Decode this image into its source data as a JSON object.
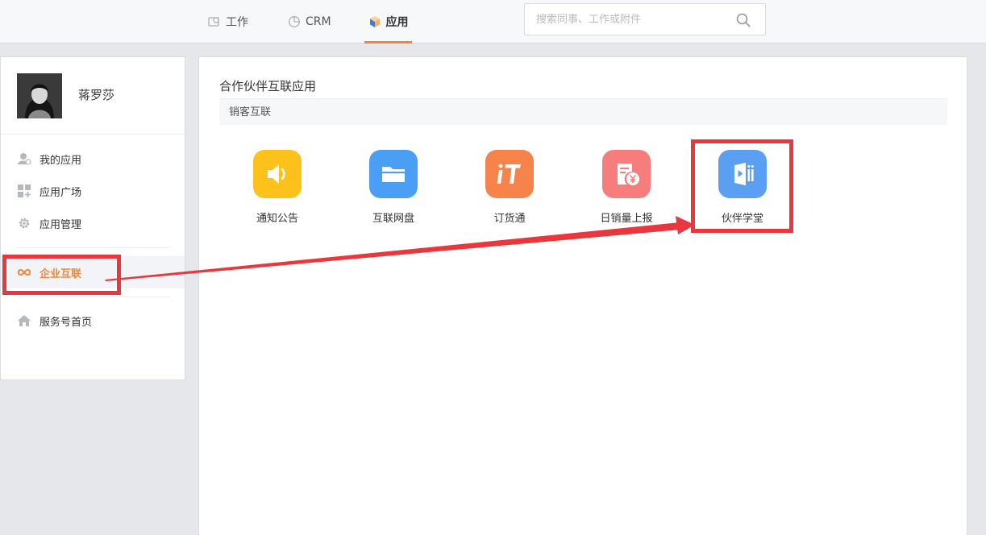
{
  "nav": {
    "tabs": [
      {
        "label": "工作",
        "icon": "work-icon",
        "active": false
      },
      {
        "label": "CRM",
        "icon": "pie-chart-icon",
        "active": false
      },
      {
        "label": "应用",
        "icon": "cube-icon",
        "active": true
      }
    ],
    "search_placeholder": "搜索同事、工作或附件"
  },
  "sidebar": {
    "username": "蒋罗莎",
    "items": [
      {
        "label": "我的应用",
        "icon": "user-app-icon"
      },
      {
        "label": "应用广场",
        "icon": "grid-icon"
      },
      {
        "label": "应用管理",
        "icon": "gear-icon"
      },
      {
        "label": "企业互联",
        "icon": "infinity-icon",
        "active": true
      },
      {
        "label": "服务号首页",
        "icon": "home-icon"
      }
    ]
  },
  "main": {
    "title": "合作伙伴互联应用",
    "subheader": "销客互联",
    "apps": [
      {
        "label": "通知公告",
        "icon": "speaker-icon",
        "color": "#fcc21b"
      },
      {
        "label": "互联网盘",
        "icon": "folder-icon",
        "color": "#4a9ff5"
      },
      {
        "label": "订货通",
        "icon": "order-it-icon",
        "color": "#f5834a"
      },
      {
        "label": "日销量上报",
        "icon": "sales-report-icon",
        "color": "#f77c7c"
      },
      {
        "label": "伙伴学堂",
        "icon": "video-book-icon",
        "color": "#5a9ff2"
      }
    ]
  },
  "colors": {
    "accent": "#f0873a",
    "annotation": "#e8383d"
  }
}
